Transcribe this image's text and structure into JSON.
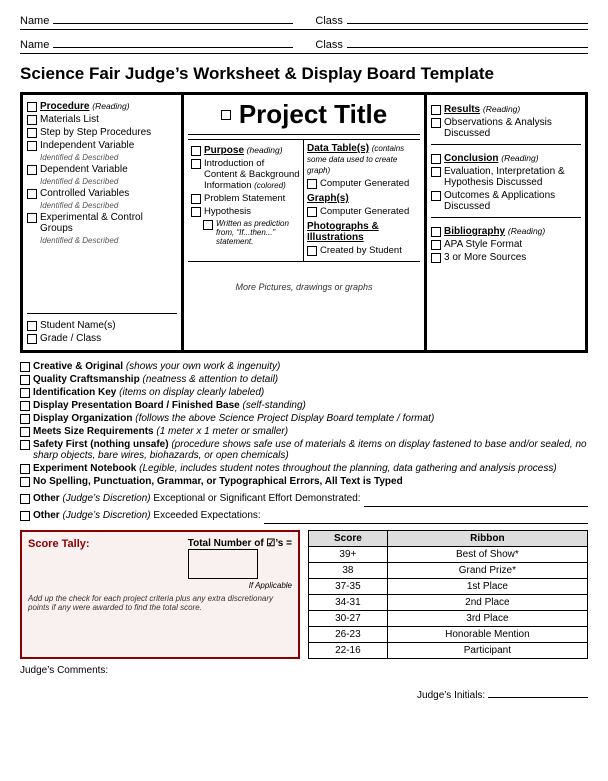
{
  "header": {
    "name_label": "Name",
    "class_label": "Class",
    "name_label2": "Name",
    "class_label2": "Class"
  },
  "page_title": "Science Fair Judge’s Worksheet & Display Board Template",
  "left_col": {
    "procedure_heading": "Procedure",
    "procedure_sub": "(Reading)",
    "items": [
      {
        "text": "Materials List"
      },
      {
        "text": "Step by Step Procedures"
      },
      {
        "text": "Independent Variable",
        "sub": "Identified & Described"
      },
      {
        "text": "Dependent Variable",
        "sub": "Identified & Described"
      },
      {
        "text": "Controlled Variables",
        "sub": "Identified & Described"
      },
      {
        "text": "Experimental & Control Groups",
        "sub": "Identified & Described"
      }
    ],
    "bottom_items": [
      {
        "text": "Student Name(s)"
      },
      {
        "text": "Grade / Class"
      }
    ]
  },
  "center_col": {
    "small_box": "□",
    "project_title": "Project Title",
    "purpose_heading": "Purpose",
    "purpose_sub": "(heading)",
    "purpose_items": [
      {
        "text": "Introduction of Content & Background Information",
        "sub": "(colored)"
      },
      {
        "text": "Problem Statement"
      },
      {
        "text": "Hypothesis"
      }
    ],
    "hypothesis_sub": "Written as prediction from, “If...then...” statement.",
    "right_sub_heading": "Data Table(s)",
    "right_sub_heading_note": "(contains some data used to create graph)",
    "data_items": [
      {
        "text": "Computer Generated"
      }
    ],
    "graph_heading": "Graph(s)",
    "graph_items": [
      {
        "text": "Computer Generated"
      }
    ],
    "photo_heading": "Photographs & Illustrations",
    "photo_items": [
      {
        "text": "Created by Student"
      }
    ],
    "bottom_text": "More Pictures, drawings or graphs"
  },
  "right_col": {
    "results_heading": "Results",
    "results_sub": "(Reading)",
    "results_items": [
      {
        "text": "Observations & Analysis Discussed"
      }
    ],
    "conclusion_heading": "Conclusion",
    "conclusion_sub": "(Reading)",
    "conclusion_items": [
      {
        "text": "Evaluation, Interpretation & Hypothesis Discussed"
      },
      {
        "text": "Outcomes & Applications Discussed"
      }
    ],
    "bibliography_heading": "Bibliography",
    "bibliography_sub": "(Reading)",
    "bibliography_items": [
      {
        "text": "APA Style Format"
      },
      {
        "text": "3 or More Sources"
      }
    ]
  },
  "criteria": [
    {
      "bold": "Creative & Original",
      "italic": "(shows your own work & ingenuity)"
    },
    {
      "bold": "Quality Craftsmanship",
      "italic": "(neatness & attention to detail)"
    },
    {
      "bold": "Identification Key",
      "italic": "(items on display clearly labeled)"
    },
    {
      "bold": "Display Presentation Board / Finished Base",
      "italic": "(self-standing)"
    },
    {
      "bold": "Display Organization",
      "italic": "(follows the above Science Project Display Board template / format)"
    },
    {
      "bold": "Meets Size Requirements",
      "italic": "(1 meter x 1 meter or smaller)"
    },
    {
      "bold": "Safety First (nothing unsafe)",
      "italic": "(procedure shows safe use of materials & items on display fastened to base and/or sealed, no sharp objects, bare wires, biohazards, or open chemicals)"
    },
    {
      "bold": "Experiment Notebook",
      "italic": "(Legible, includes student notes throughout the planning, data gathering and analysis process)"
    },
    {
      "bold": "No Spelling, Punctuation, Grammar, or Typographical Errors, All Text is Typed",
      "italic": ""
    }
  ],
  "other": [
    {
      "label": "Other",
      "italic": "(Judge’s Discretion)",
      "suffix": "Exceptional or Significant Effort Demonstrated:"
    },
    {
      "label": "Other",
      "italic": "(Judge’s Discretion)",
      "suffix": "Exceeded Expectations:"
    }
  ],
  "score_tally": {
    "title": "Score Tally:",
    "desc": "Add up the check for each project criteria plus any extra discretionary points if any were awarded to find the total score.",
    "total_label": "Total Number of ☑’s =",
    "if_applicable": "If Applicable"
  },
  "ribbon_table": {
    "headers": [
      "Score",
      "Ribbon"
    ],
    "rows": [
      {
        "score": "39+",
        "ribbon": "Best of Show*"
      },
      {
        "score": "38",
        "ribbon": "Grand Prize*"
      },
      {
        "score": "37-35",
        "ribbon": "1st Place"
      },
      {
        "score": "34-31",
        "ribbon": "2nd Place"
      },
      {
        "score": "30-27",
        "ribbon": "3rd Place"
      },
      {
        "score": "26-23",
        "ribbon": "Honorable Mention"
      },
      {
        "score": "22-16",
        "ribbon": "Participant"
      }
    ]
  },
  "judges_comments_label": "Judge’s Comments:",
  "judges_initials_label": "Judge’s Initials:"
}
